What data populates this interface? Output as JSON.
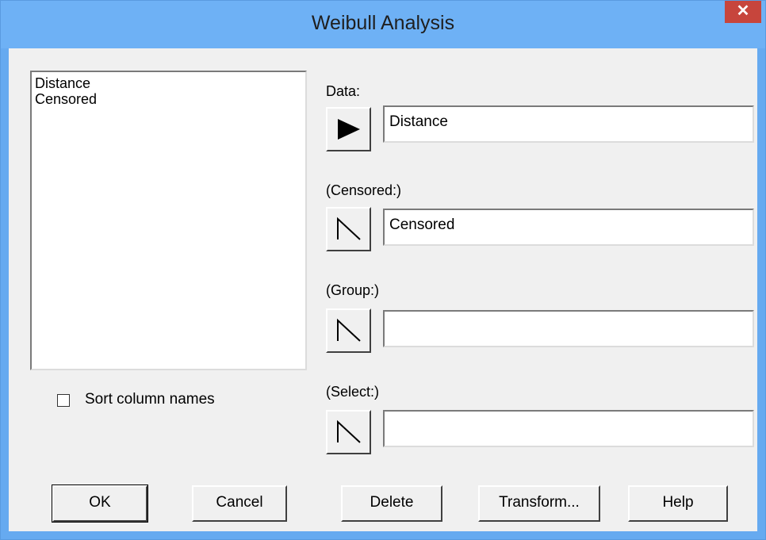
{
  "window": {
    "title": "Weibull Analysis",
    "close_glyph": "✕"
  },
  "listbox": {
    "items": [
      "Distance",
      "Censored"
    ]
  },
  "sort_checkbox": {
    "label": "Sort column names",
    "checked": false
  },
  "fields": {
    "data": {
      "label": "Data:",
      "value": "Distance",
      "button_icon": "filled-play-arrow-icon"
    },
    "censored": {
      "label": "(Censored:)",
      "value": "Censored",
      "button_icon": "outline-arrow-icon"
    },
    "group": {
      "label": "(Group:)",
      "value": "",
      "button_icon": "outline-arrow-icon"
    },
    "select": {
      "label": "(Select:)",
      "value": "",
      "button_icon": "outline-arrow-icon"
    }
  },
  "buttons": {
    "ok": "OK",
    "cancel": "Cancel",
    "delete": "Delete",
    "transform": "Transform...",
    "help": "Help"
  }
}
